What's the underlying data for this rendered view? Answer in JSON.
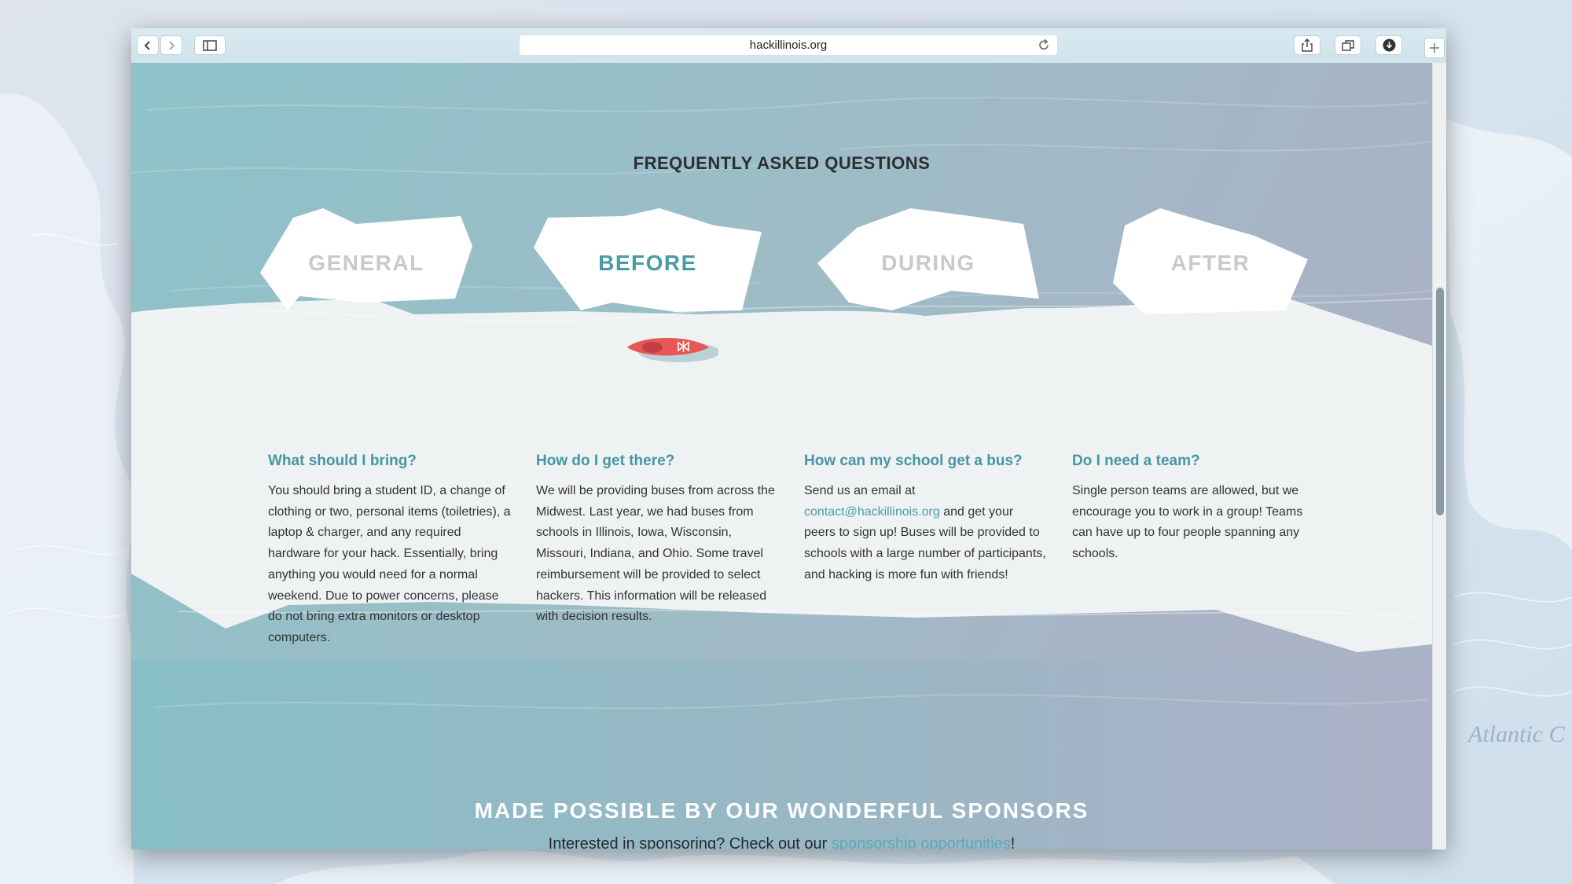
{
  "browser": {
    "url": "hackillinois.org"
  },
  "desktop": {
    "map_label": "Atlantic C"
  },
  "faq": {
    "title": "FREQUENTLY ASKED QUESTIONS",
    "tabs": [
      {
        "label": "GENERAL",
        "active": false
      },
      {
        "label": "BEFORE",
        "active": true
      },
      {
        "label": "DURING",
        "active": false
      },
      {
        "label": "AFTER",
        "active": false
      }
    ],
    "questions": [
      {
        "q": "What should I bring?",
        "a": "You should bring a student ID, a change of clothing or two, personal items (toiletries), a laptop & charger, and any required hardware for your hack. Essentially, bring anything you would need for a normal weekend. Due to power concerns, please do not bring extra monitors or desktop computers."
      },
      {
        "q": "How do I get there?",
        "a": "We will be providing buses from across the Midwest. Last year, we had buses from schools in Illinois, Iowa, Wisconsin, Missouri, Indiana, and Ohio. Some travel reimbursement will be provided to select hackers. This information will be released with decision results."
      },
      {
        "q": "How can my school get a bus?",
        "a_before": "Send us an email at ",
        "a_link": "contact@hackillinois.org",
        "a_after": " and get your peers to sign up! Buses will be provided to schools with a large number of participants, and hacking is more fun with friends!"
      },
      {
        "q": "Do I need a team?",
        "a": "Single person teams are allowed, but we encourage you to work in a group! Teams can have up to four people spanning any schools."
      }
    ]
  },
  "sponsors": {
    "title": "MADE POSSIBLE BY OUR WONDERFUL SPONSORS",
    "line_before": "Interested in sponsoring? Check out our ",
    "line_link": "sponsorship opportunities",
    "line_after": "!"
  },
  "colors": {
    "accent": "#4696a3",
    "kayak": "#e85757",
    "water_top": "#8fc0c8",
    "water_right": "#a9b2c6",
    "ice": "#eef2f3"
  }
}
